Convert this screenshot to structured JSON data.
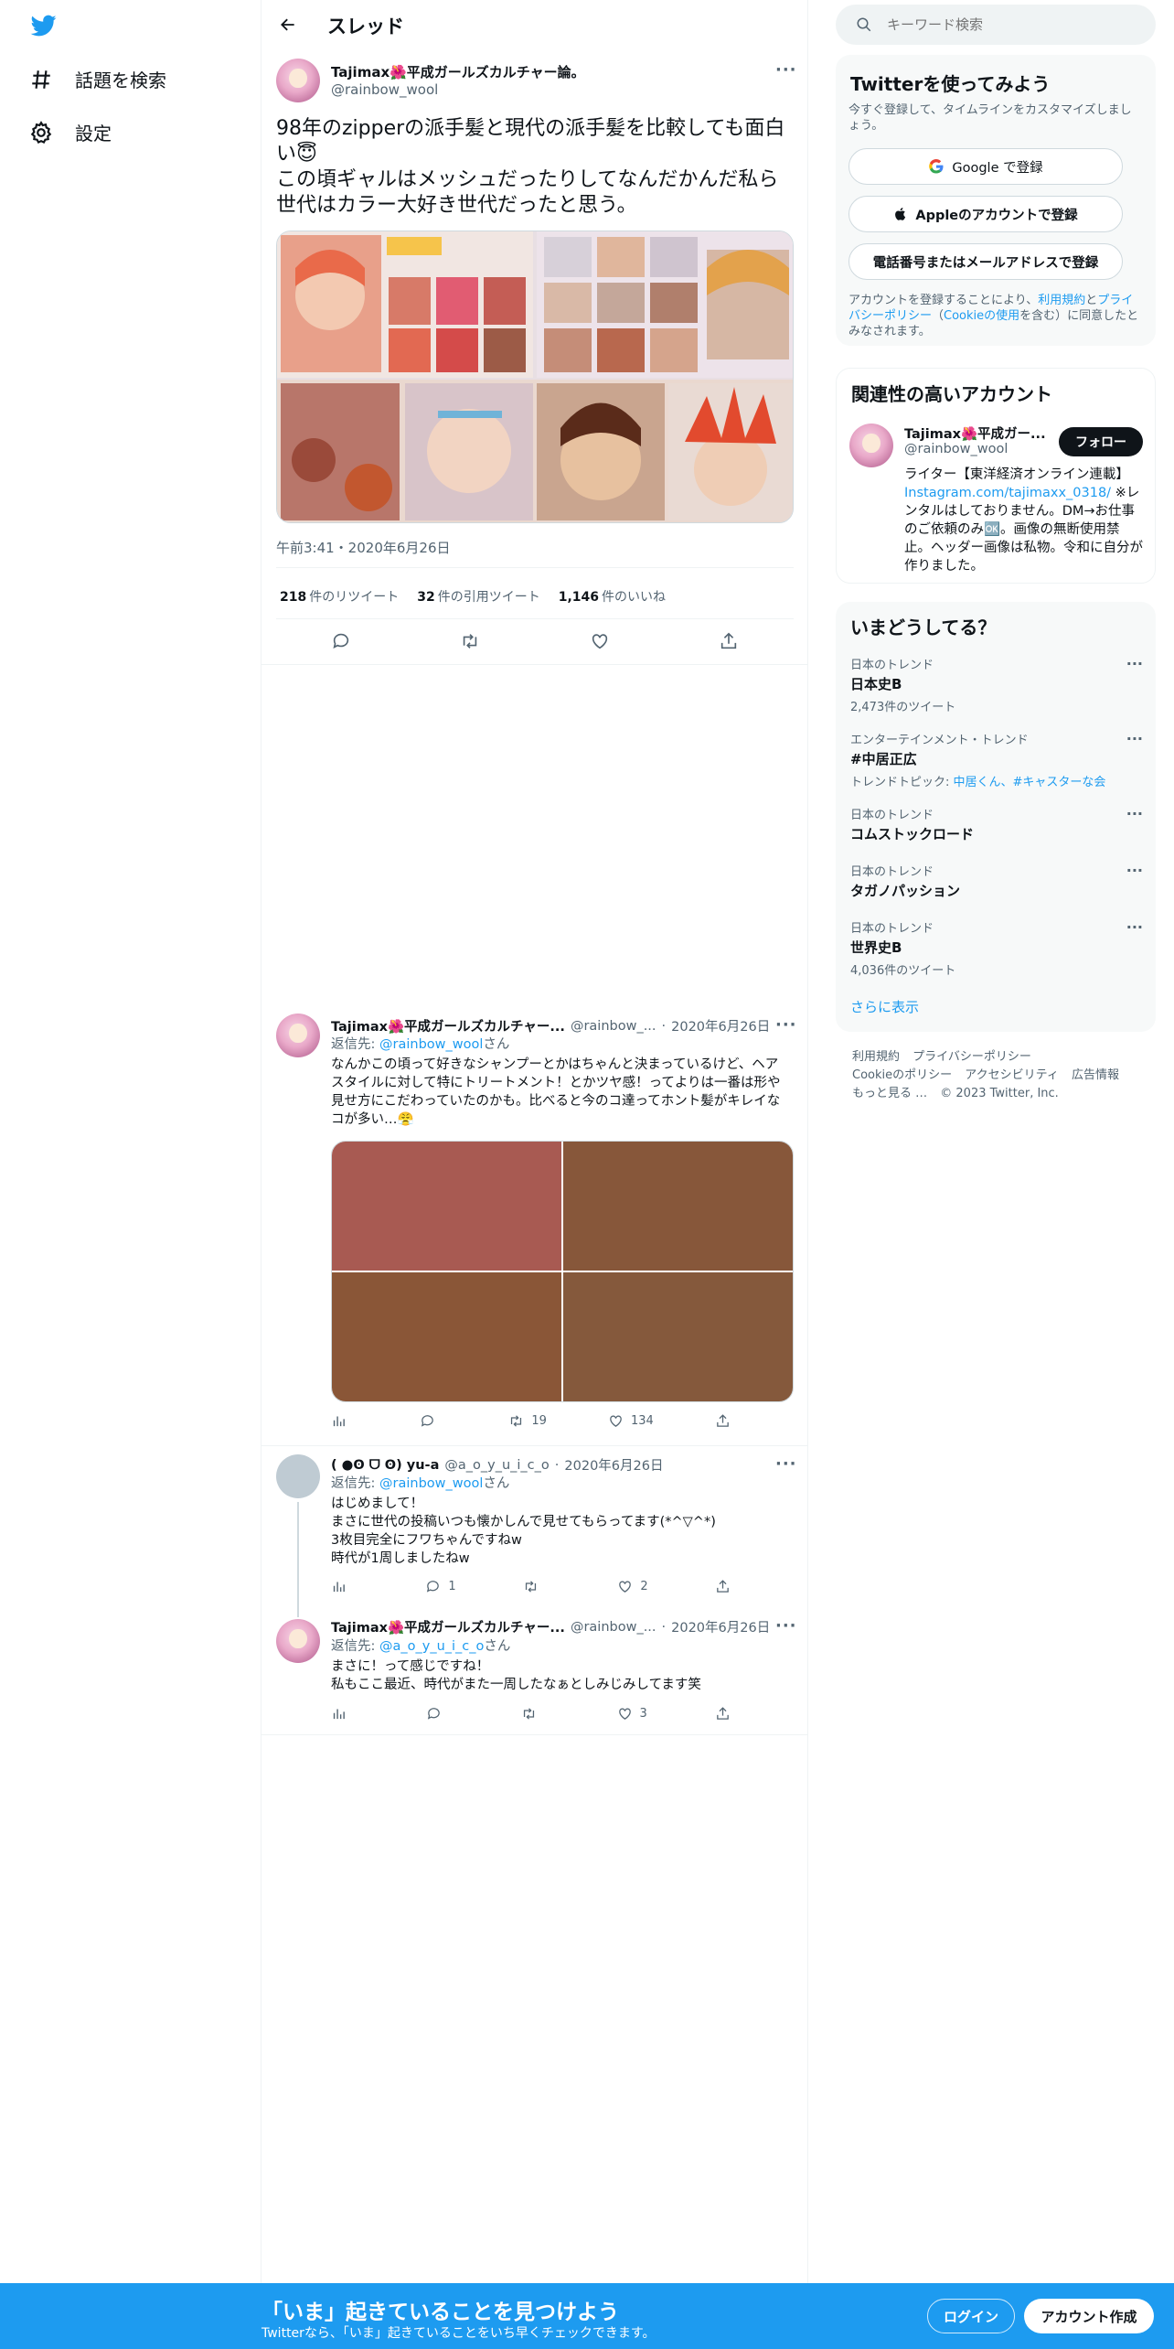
{
  "colors": {
    "accent": "#1d9bf0",
    "text": "#0f1419",
    "muted": "#536471",
    "border": "#eff3f4",
    "banner": "#1d9bf0"
  },
  "nav": {
    "logo_icon": "twitter-bird-icon",
    "items": [
      {
        "icon": "hashtag-icon",
        "label": "話題を検索"
      },
      {
        "icon": "gear-icon",
        "label": "設定"
      }
    ]
  },
  "thread": {
    "title": "スレッド",
    "main_tweet": {
      "name": "Tajimax🌺平成ガールズカルチャー論。",
      "handle": "@rainbow_wool",
      "text": "98年のzipperの派手髪と現代の派手髪を比較しても面白い😇\nこの頃ギャルはメッシュだったりしてなんだかんだ私ら世代はカラー大好き世代だったと思う。",
      "time": "午前3:41・2020年6月26日",
      "stats": {
        "retweets": "218",
        "retweets_label": "件のリツイート",
        "quotes": "32",
        "quotes_label": "件の引用ツイート",
        "likes": "1,146",
        "likes_label": "件のいいね"
      }
    },
    "replies": [
      {
        "name": "Tajimax🌺平成ガールズカルチャー...",
        "handle": "@rainbow_...",
        "date": "2020年6月26日",
        "reply_to_prefix": "返信先: ",
        "reply_to": "@rainbow_wool",
        "reply_to_suffix": "さん",
        "text": "なんかこの頃って好きなシャンプーとかはちゃんと決まっているけど、ヘアスタイルに対して特にトリートメント！とかツヤ感！ってよりは一番は形や見せ方にこだわっていたのかも。比べると今のコ達ってホント髪がキレイなコが多い…😤",
        "media_colors": [
          "#a85a52",
          "#87573a",
          "#8a5637",
          "#85593c"
        ],
        "counts": {
          "replies": "",
          "retweets": "19",
          "likes": "134"
        }
      },
      {
        "name": "( ●ʘ ᗜ ʘ) yu-a",
        "handle": "@a_o_y_u_i_c_o",
        "date": "2020年6月26日",
        "reply_to_prefix": "返信先: ",
        "reply_to": "@rainbow_wool",
        "reply_to_suffix": "さん",
        "text": "はじめまして！\nまさに世代の投稿いつも懐かしんで見せてもらってます(*^▽^*)\n3枚目完全にフワちゃんですねw\n時代が1周しましたねw",
        "counts": {
          "replies": "1",
          "retweets": "",
          "likes": "2"
        }
      },
      {
        "name": "Tajimax🌺平成ガールズカルチャー...",
        "handle": "@rainbow_...",
        "date": "2020年6月26日",
        "reply_to_prefix": "返信先: ",
        "reply_to": "@a_o_y_u_i_c_o",
        "reply_to_suffix": "さん",
        "text": "まさに！って感じですね！\n私もここ最近、時代がまた一周したなぁとしみじみしてます笑",
        "counts": {
          "replies": "",
          "retweets": "",
          "likes": "3"
        }
      }
    ]
  },
  "search": {
    "placeholder": "キーワード検索"
  },
  "signup_card": {
    "title": "Twitterを使ってみよう",
    "subtitle": "今すぐ登録して、タイムラインをカスタマイズしましょう。",
    "google": "Google で登録",
    "apple": "Appleのアカウントで登録",
    "phone": "電話番号またはメールアドレスで登録",
    "terms_prefix": "アカウントを登録することにより、",
    "terms_link": "利用規約",
    "terms_and": "と",
    "privacy_link": "プライバシーポリシー",
    "cookie_open": "（",
    "cookie_link": "Cookieの使用",
    "cookie_close": "を含む）に同意したとみなされます。"
  },
  "related": {
    "title": "関連性の高いアカウント",
    "name": "Tajimax🌺平成ガー...",
    "handle": "@rainbow_wool",
    "follow": "フォロー",
    "bio_1": "ライター【東洋経済オンライン連載】",
    "bio_link": "Instagram.com/tajimaxx_0318/",
    "bio_2": " ※レンタルはしておりません。DM→お仕事のご依頼のみ🆗。画像の無断使用禁止。ヘッダー画像は私物。令和に自分が作りました。"
  },
  "trends": {
    "title": "いまどうしてる？",
    "items": [
      {
        "category": "日本のトレンド",
        "name": "日本史B",
        "count": "2,473件のツイート"
      },
      {
        "category": "エンターテインメント・トレンド",
        "name": "#中居正広",
        "topic_prefix": "トレンドトピック: ",
        "topic": "中居くん、#キャスターな会"
      },
      {
        "category": "日本のトレンド",
        "name": "コムストックロード"
      },
      {
        "category": "日本のトレンド",
        "name": "タガノパッション"
      },
      {
        "category": "日本のトレンド",
        "name": "世界史B",
        "count": "4,036件のツイート"
      }
    ],
    "show_more": "さらに表示"
  },
  "footer": {
    "links": [
      "利用規約",
      "プライバシーポリシー",
      "Cookieのポリシー",
      "アクセシビリティ",
      "広告情報",
      "もっと見る …"
    ],
    "copyright": "© 2023 Twitter, Inc."
  },
  "banner": {
    "title": "「いま」起きていることを見つけよう",
    "subtitle": "Twitterなら、「いま」起きていることをいち早くチェックできます。",
    "login": "ログイン",
    "signup": "アカウント作成"
  }
}
